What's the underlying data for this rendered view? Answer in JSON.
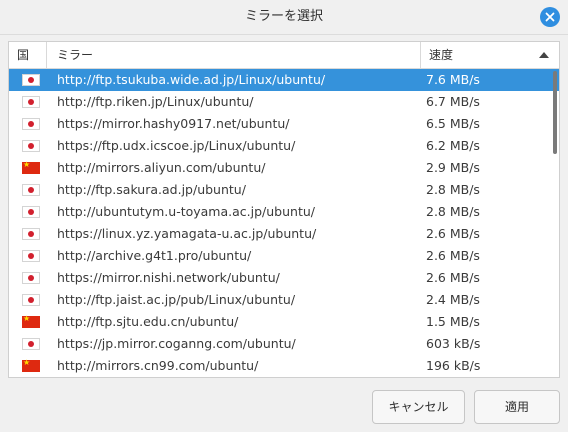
{
  "dialog": {
    "title": "ミラーを選択"
  },
  "table": {
    "columns": {
      "country": "国",
      "mirror": "ミラー",
      "speed": "速度"
    },
    "sort": {
      "column": "speed",
      "direction": "descending"
    },
    "rows": [
      {
        "flag": "jp",
        "url": "http://ftp.tsukuba.wide.ad.jp/Linux/ubuntu/",
        "speed": "7.6 MB/s",
        "selected": true
      },
      {
        "flag": "jp",
        "url": "http://ftp.riken.jp/Linux/ubuntu/",
        "speed": "6.7 MB/s"
      },
      {
        "flag": "jp",
        "url": "https://mirror.hashy0917.net/ubuntu/",
        "speed": "6.5 MB/s"
      },
      {
        "flag": "jp",
        "url": "https://ftp.udx.icscoe.jp/Linux/ubuntu/",
        "speed": "6.2 MB/s"
      },
      {
        "flag": "cn",
        "url": "http://mirrors.aliyun.com/ubuntu/",
        "speed": "2.9 MB/s"
      },
      {
        "flag": "jp",
        "url": "http://ftp.sakura.ad.jp/ubuntu/",
        "speed": "2.8 MB/s"
      },
      {
        "flag": "jp",
        "url": "http://ubuntutym.u-toyama.ac.jp/ubuntu/",
        "speed": "2.8 MB/s"
      },
      {
        "flag": "jp",
        "url": "https://linux.yz.yamagata-u.ac.jp/ubuntu/",
        "speed": "2.6 MB/s"
      },
      {
        "flag": "jp",
        "url": "http://archive.g4t1.pro/ubuntu/",
        "speed": "2.6 MB/s"
      },
      {
        "flag": "jp",
        "url": "https://mirror.nishi.network/ubuntu/",
        "speed": "2.6 MB/s"
      },
      {
        "flag": "jp",
        "url": "http://ftp.jaist.ac.jp/pub/Linux/ubuntu/",
        "speed": "2.4 MB/s"
      },
      {
        "flag": "cn",
        "url": "http://ftp.sjtu.edu.cn/ubuntu/",
        "speed": "1.5 MB/s"
      },
      {
        "flag": "jp",
        "url": "https://jp.mirror.coganng.com/ubuntu/",
        "speed": "603 kB/s"
      },
      {
        "flag": "cn",
        "url": "http://mirrors.cn99.com/ubuntu/",
        "speed": "196 kB/s"
      }
    ]
  },
  "buttons": {
    "cancel": "キャンセル",
    "apply": "適用"
  },
  "colors": {
    "accent": "#3592db",
    "close_button": "#2f8ee0"
  },
  "icons": {
    "close": "close-icon",
    "sort": "sort-ascending-icon",
    "flag_jp": "flag-japan-icon",
    "flag_cn": "flag-china-icon"
  }
}
